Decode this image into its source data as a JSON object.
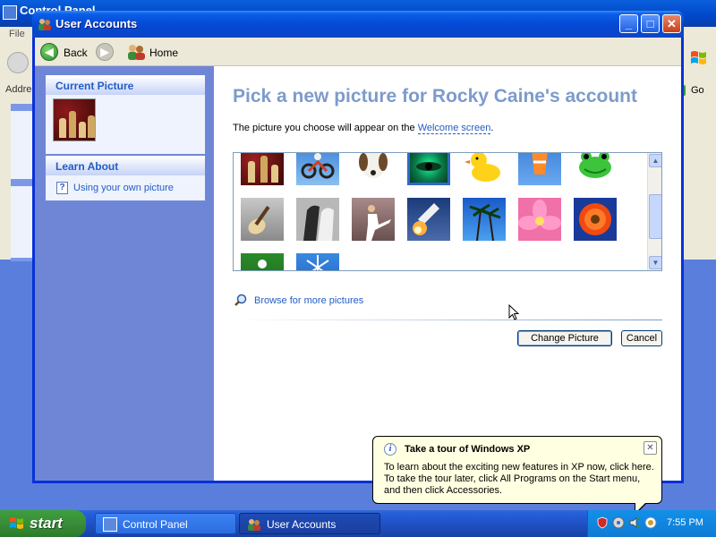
{
  "background_window": {
    "title": "Control Panel",
    "menu_file": "File",
    "address_label": "Addres",
    "go_label": "Go"
  },
  "window": {
    "title": "User Accounts"
  },
  "toolbar": {
    "back_label": "Back",
    "home_label": "Home"
  },
  "sidebar": {
    "current_picture_header": "Current Picture",
    "learn_about_header": "Learn About",
    "learn_link": "Using your own picture"
  },
  "main": {
    "title": "Pick a new picture for Rocky Caine's account",
    "description_prefix": "The picture you choose will appear on the ",
    "description_link": "Welcome screen",
    "description_suffix": ".",
    "pictures": [
      "chess",
      "dirt bike",
      "dog",
      "green eye",
      "rubber duck",
      "fish",
      "frog",
      "guitar",
      "horses",
      "karate",
      "space shuttle",
      "palm trees",
      "pink flower",
      "red daisy",
      "golf",
      "snowflake"
    ],
    "selected_picture": "green eye",
    "browse_link": "Browse for more pictures",
    "change_button": "Change Picture",
    "cancel_button": "Cancel"
  },
  "balloon": {
    "title": "Take a tour of Windows XP",
    "text": "To learn about the exciting new features in XP now, click here. To take the tour later, click All Programs on the Start menu, and then click Accessories."
  },
  "taskbar": {
    "start_label": "start",
    "tasks": [
      "Control Panel",
      "User Accounts"
    ],
    "clock": "7:55 PM"
  },
  "colors": {
    "title_blue": "#0548d4",
    "heading": "#7d9bcb",
    "link": "#215dc6",
    "start_green": "#3a8d3a",
    "balloon_bg": "#ffffe1"
  }
}
